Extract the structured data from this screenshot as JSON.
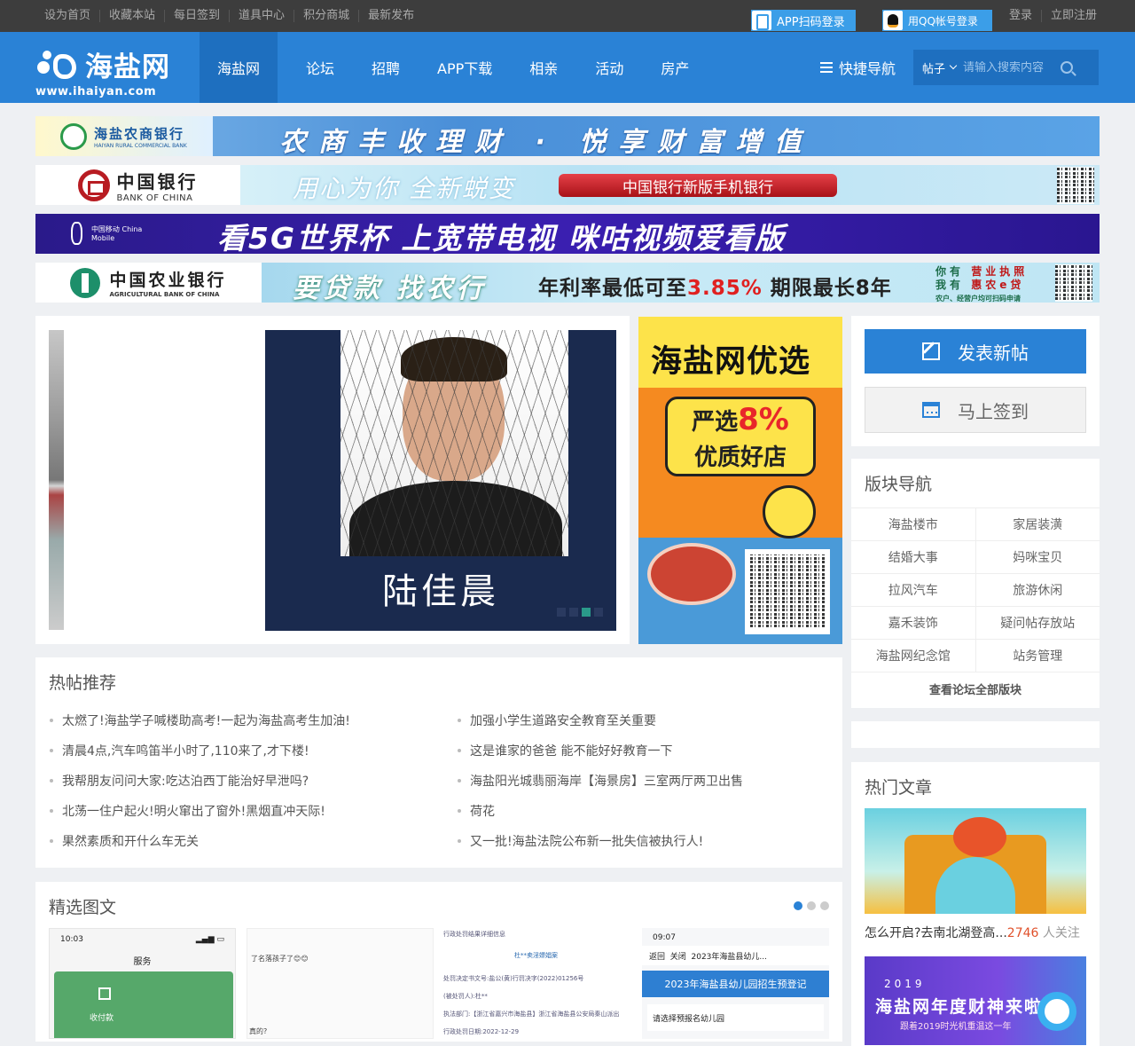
{
  "topbar": {
    "left_links": [
      "设为首页",
      "收藏本站",
      "每日签到",
      "道具中心",
      "积分商城",
      "最新发布"
    ],
    "app_login": "APP扫码登录",
    "qq_login": "用QQ帐号登录",
    "right_links": [
      "登录",
      "立即注册"
    ]
  },
  "logo": {
    "name": "海盐网",
    "url": "www.ihaiyan.com"
  },
  "nav": {
    "items": [
      "海盐网",
      "论坛",
      "招聘",
      "APP下载",
      "相亲",
      "活动",
      "房产"
    ],
    "active": "海盐网",
    "quick_nav": "快捷导航",
    "search_type": "帖子",
    "search_placeholder": "请输入搜索内容"
  },
  "ads": {
    "rcb": {
      "bank_name": "海盐农商银行",
      "bank_en": "HAIYAN RURAL COMMERCIAL BANK",
      "slogan": "农商丰收理财 · 悦享财富增值"
    },
    "boc": {
      "bank_name": "中国银行",
      "bank_en": "BANK OF CHINA",
      "slogan": "用心为你 全新蜕变",
      "button": "中国银行新版手机银行"
    },
    "cmcc": {
      "sponsor": "中国移动 China Mobile",
      "slogan": "看5G世界杯 上宽带电视 咪咕视频爱看版"
    },
    "abc": {
      "bank_name": "中国农业银行",
      "bank_en": "AGRICULTURAL BANK OF CHINA",
      "slogan": "要贷款 找农行",
      "rate_prefix": "年利率最低可至",
      "rate": "3.85%",
      "rate_suffix": " 期限最长8年",
      "side_line1_a": "你有",
      "side_line1_b": "营业执照",
      "side_line2_a": "我有",
      "side_line2_b": "惠农e贷",
      "side_note": "农户、经营户均可扫码申请"
    }
  },
  "slider": {
    "caption": "陆佳晨",
    "dots": 4,
    "active_dot": 3
  },
  "side_ad": {
    "title": "海盐网优选",
    "line1": "严选",
    "highlight": "8%",
    "line2": "优质好店"
  },
  "actions": {
    "post": "发表新帖",
    "sign": "马上签到"
  },
  "board_nav": {
    "title": "版块导航",
    "rows": [
      [
        "海盐楼市",
        "家居装潢"
      ],
      [
        "结婚大事",
        "妈咪宝贝"
      ],
      [
        "拉风汽车",
        "旅游休闲"
      ],
      [
        "嘉禾装饰",
        "疑问帖存放站"
      ],
      [
        "海盐网纪念馆",
        "站务管理"
      ]
    ],
    "all": "查看论坛全部版块"
  },
  "hot_articles": {
    "title": "热门文章",
    "item1_caption": "怎么开启?去南北湖登高...",
    "item1_count": "2746",
    "item1_suffix": "人关注",
    "item2_year": "2019",
    "item2_title": "海盐网年度财神来啦!",
    "item2_sub": "跟着2019时光机重温这一年"
  },
  "hot_posts": {
    "title": "热帖推荐",
    "left": [
      "太燃了!海盐学子喊楼助高考!一起为海盐高考生加油!",
      "清晨4点,汽车鸣笛半小时了,110来了,才下楼!",
      "我帮朋友问问大家:吃达泊西丁能治好早泄吗?",
      "北荡一住户起火!明火窜出了窗外!黑烟直冲天际!",
      "果然素质和开什么车无关"
    ],
    "right": [
      "加强小学生道路安全教育至关重要",
      "这是谁家的爸爸 能不能好好教育一下",
      "海盐阳光城翡丽海岸【海景房】三室两厅两卫出售",
      "荷花",
      "又一批!海盐法院公布新一批失信被执行人!"
    ]
  },
  "picks": {
    "title": "精选图文",
    "dots": 3,
    "thumb1": {
      "time": "10:03",
      "header": "服务",
      "action": "收付款"
    },
    "thumb2": {
      "text": "了名落孩子了😊😊",
      "text2": "真的?"
    },
    "thumb3": {
      "lines": [
        "行政处罚结果详细信息",
        "杜**卖淫嫖娼案",
        "处罚决定书文号:盐公(黄)行罚决字(2022)01256号",
        "(被处罚人):杜**",
        "执法部门:【浙江省嘉兴市海盐县】浙江省海盐县公安局秦山派出",
        "行政处罚日期:2022-12-29"
      ]
    },
    "thumb4": {
      "time": "09:07",
      "back": "返回",
      "close": "关闭",
      "header": "2023年海盐县幼儿...",
      "banner": "2023年海盐县幼儿园招生预登记",
      "select": "请选择预报名幼儿园"
    }
  }
}
